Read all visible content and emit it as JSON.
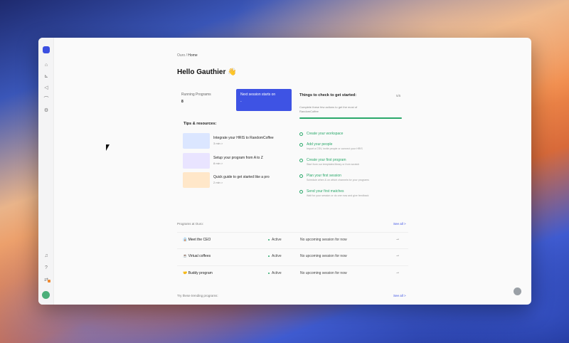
{
  "app": {
    "breadcrumb": {
      "root": "Ouro",
      "separator": "/",
      "current": "Home"
    },
    "greeting": "Hello Gauthier 👋"
  },
  "rail": {
    "icons": [
      "home-icon",
      "chart-icon",
      "megaphone-icon",
      "rss-icon",
      "settings-icon",
      "bell-icon",
      "help-icon",
      "switch-icon"
    ]
  },
  "stats": {
    "running_label": "Running Programs",
    "running_value": "8",
    "next_session_label": "Next session starts on",
    "next_session_value": "-"
  },
  "tips": {
    "title": "Tips & resources:",
    "items": [
      {
        "title": "Integrate your HRIS to RandomCoffee",
        "meta": "3 min >",
        "color": "#dbe6ff"
      },
      {
        "title": "Setup your program from A to Z",
        "meta": "8 min >",
        "color": "#e9e4ff"
      },
      {
        "title": "Quick guide to get started like a pro",
        "meta": "2 min >",
        "color": "#ffe7c9"
      }
    ]
  },
  "checklist": {
    "title": "Things to check to get started:",
    "count": "5/5",
    "description": "Complete these few actions to get the most of RandomCoffee",
    "progress": 1.0,
    "items": [
      {
        "title": "Create your workspace",
        "sub": ""
      },
      {
        "title": "Add your people",
        "sub": "Import a CSV, invite people or connect your HRIS"
      },
      {
        "title": "Create your first program",
        "sub": "Start from our templates library or from scratch"
      },
      {
        "title": "Plan your first session",
        "sub": "Schedule when & on which channels for your programs"
      },
      {
        "title": "Send your first matches",
        "sub": "Wait for your session or do one now and give feedback"
      }
    ]
  },
  "programs": {
    "label": "Programs at Ouro:",
    "see_all": "See all >",
    "rows": [
      {
        "name": "👔 Meet the CEO",
        "status": "Active",
        "session": "No upcoming session for now",
        "arrow": "→"
      },
      {
        "name": "☕ Virtual coffees",
        "status": "Active",
        "session": "No upcoming session for now",
        "arrow": "→"
      },
      {
        "name": "🤝 Buddy program",
        "status": "Active",
        "session": "No upcoming session for now",
        "arrow": "→"
      }
    ]
  },
  "trending": {
    "label": "Try these trending programs:",
    "see_all": "See all >"
  }
}
